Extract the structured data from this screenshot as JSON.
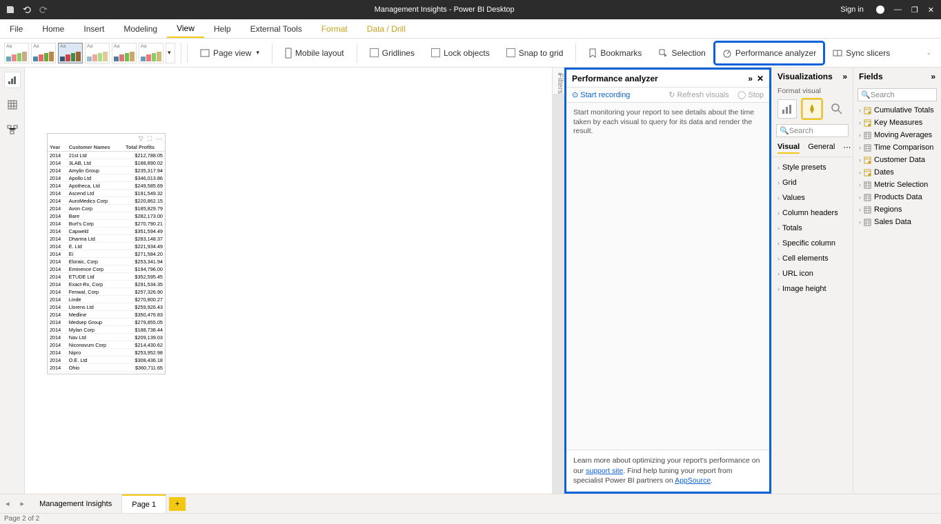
{
  "titlebar": {
    "title": "Management Insights - Power BI Desktop",
    "signin": "Sign in"
  },
  "menu": {
    "items": [
      "File",
      "Home",
      "Insert",
      "Modeling",
      "View",
      "Help",
      "External Tools",
      "Format",
      "Data / Drill"
    ],
    "active": "View",
    "orange": [
      "Format",
      "Data / Drill"
    ]
  },
  "ribbon": {
    "pageview": "Page view",
    "mobile": "Mobile layout",
    "gridlines": "Gridlines",
    "lock": "Lock objects",
    "snap": "Snap to grid",
    "bookmarks": "Bookmarks",
    "selection": "Selection",
    "perf": "Performance analyzer",
    "sync": "Sync slicers"
  },
  "perf": {
    "title": "Performance analyzer",
    "start": "Start recording",
    "refresh": "Refresh visuals",
    "stop": "Stop",
    "body": "Start monitoring your report to see details about the time taken by each visual to query for its data and render the result.",
    "foot1": "Learn more about optimizing your report's performance on our ",
    "link1": "support site",
    "foot2": ". Find help tuning your report from specialist Power BI partners on ",
    "link2": "AppSource",
    "foot3": "."
  },
  "viz": {
    "title": "Visualizations",
    "sub": "Format visual",
    "search": "Search",
    "tabs": [
      "Visual",
      "General"
    ],
    "sections": [
      "Style presets",
      "Grid",
      "Values",
      "Column headers",
      "Totals",
      "Specific column",
      "Cell elements",
      "URL icon",
      "Image height"
    ]
  },
  "fields": {
    "title": "Fields",
    "search": "Search",
    "items": [
      {
        "name": "Cumulative Totals",
        "icon": "measure"
      },
      {
        "name": "Key Measures",
        "icon": "measure"
      },
      {
        "name": "Moving Averages",
        "icon": "table"
      },
      {
        "name": "Time Comparison",
        "icon": "table"
      },
      {
        "name": "Customer Data",
        "icon": "measure"
      },
      {
        "name": "Dates",
        "icon": "measure"
      },
      {
        "name": "Metric Selection",
        "icon": "table"
      },
      {
        "name": "Products Data",
        "icon": "table"
      },
      {
        "name": "Regions",
        "icon": "table"
      },
      {
        "name": "Sales Data",
        "icon": "table"
      }
    ]
  },
  "table": {
    "headers": [
      "Year",
      "Customer Names",
      "Total Profits"
    ],
    "rows": [
      [
        "2014",
        "21st Ltd",
        "$212,788.05"
      ],
      [
        "2014",
        "3LAB, Ltd",
        "$188,890.02"
      ],
      [
        "2014",
        "Amylin Group",
        "$235,317.94"
      ],
      [
        "2014",
        "Apollo Ltd",
        "$346,013.86"
      ],
      [
        "2014",
        "Apotheca, Ltd",
        "$249,585.69"
      ],
      [
        "2014",
        "Ascend Ltd",
        "$191,549.32"
      ],
      [
        "2014",
        "AuroMedics Corp",
        "$220,862.15"
      ],
      [
        "2014",
        "Avon Corp",
        "$185,829.79"
      ],
      [
        "2014",
        "Bare",
        "$282,173.00"
      ],
      [
        "2014",
        "Burt's Corp",
        "$270,790.21"
      ],
      [
        "2014",
        "Capweld",
        "$351,594.49"
      ],
      [
        "2014",
        "Dharma Ltd",
        "$283,148.37"
      ],
      [
        "2014",
        "E. Ltd",
        "$221,934.49"
      ],
      [
        "2014",
        "Ei",
        "$271,584.20"
      ],
      [
        "2014",
        "Eloraic, Corp",
        "$253,341.94"
      ],
      [
        "2014",
        "Eminence Corp",
        "$194,796.00"
      ],
      [
        "2014",
        "ETUDE Ltd",
        "$352,595.45"
      ],
      [
        "2014",
        "Exact-Rx, Corp",
        "$291,534.35"
      ],
      [
        "2014",
        "Fenwal, Corp",
        "$257,326.90"
      ],
      [
        "2014",
        "Linde",
        "$270,800.27"
      ],
      [
        "2014",
        "Llorens Ltd",
        "$259,926.43"
      ],
      [
        "2014",
        "Medline",
        "$350,476.83"
      ],
      [
        "2014",
        "Medsep Group",
        "$279,855.05"
      ],
      [
        "2014",
        "Mylan Corp",
        "$188,738.44"
      ],
      [
        "2014",
        "Nav Ltd",
        "$209,139.03"
      ],
      [
        "2014",
        "Niconovum Corp",
        "$214,430.62"
      ],
      [
        "2014",
        "Nipro",
        "$253,952.98"
      ],
      [
        "2014",
        "O.E. Ltd",
        "$308,436.18"
      ],
      [
        "2014",
        "Ohio",
        "$360,711.65"
      ]
    ]
  },
  "filters": {
    "label": "Filters"
  },
  "pagebar": {
    "tabs": [
      "Management Insights",
      "Page 1"
    ],
    "active": "Page 1"
  },
  "status": {
    "text": "Page 2 of 2"
  }
}
